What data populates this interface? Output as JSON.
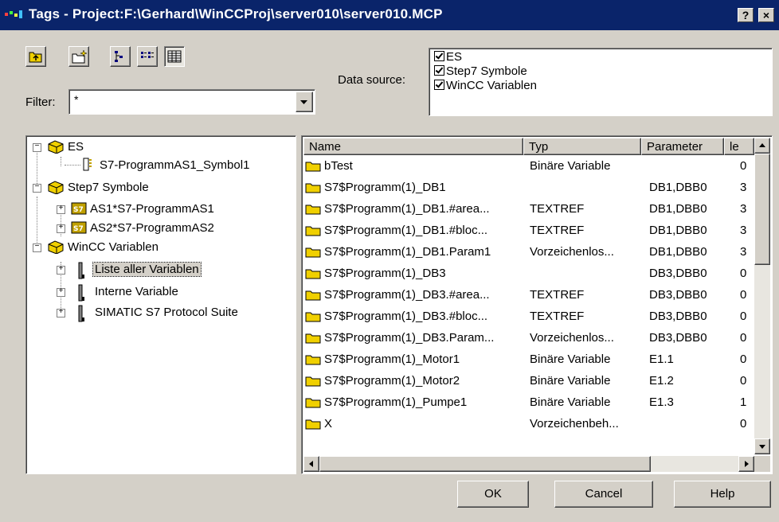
{
  "window": {
    "title": "Tags - Project:F:\\Gerhard\\WinCCProj\\server010\\server010.MCP",
    "help_btn": "?",
    "close_btn": "×"
  },
  "toolbar": {
    "icons": [
      "up-folder-icon",
      "new-folder-icon",
      "tree-view-icon",
      "list-view-icon",
      "details-view-icon"
    ]
  },
  "filter": {
    "label": "Filter:",
    "value": "*"
  },
  "datasource": {
    "label": "Data source:",
    "items": [
      {
        "label": "ES",
        "checked": true
      },
      {
        "label": "Step7 Symbole",
        "checked": true
      },
      {
        "label": "WinCC Variablen",
        "checked": true
      }
    ]
  },
  "tree": {
    "nodes": [
      {
        "label": "ES",
        "expander": "−"
      },
      {
        "label": "S7-ProgrammAS1_Symbol1"
      },
      {
        "label": "Step7 Symbole",
        "expander": "−"
      },
      {
        "label": "AS1*S7-ProgrammAS1",
        "expander": "+",
        "badge": "S7"
      },
      {
        "label": "AS2*S7-ProgrammAS2",
        "expander": "+",
        "badge": "S7"
      },
      {
        "label": "WinCC Variablen",
        "expander": "−"
      },
      {
        "label": "Liste aller Variablen",
        "expander": "+",
        "selected": true
      },
      {
        "label": "Interne Variable",
        "expander": "+"
      },
      {
        "label": "SIMATIC S7 Protocol Suite",
        "expander": "+"
      }
    ]
  },
  "table": {
    "columns": [
      "Name",
      "Typ",
      "Parameter",
      "le"
    ],
    "rows": [
      {
        "name": "bTest",
        "typ": "Binäre Variable",
        "param": "",
        "le": "0"
      },
      {
        "name": "S7$Programm(1)_DB1",
        "typ": "",
        "param": "DB1,DBB0",
        "le": "3"
      },
      {
        "name": "S7$Programm(1)_DB1.#area...",
        "typ": "TEXTREF",
        "param": "DB1,DBB0",
        "le": "3"
      },
      {
        "name": "S7$Programm(1)_DB1.#bloc...",
        "typ": "TEXTREF",
        "param": "DB1,DBB0",
        "le": "3"
      },
      {
        "name": "S7$Programm(1)_DB1.Param1",
        "typ": "Vorzeichenlos...",
        "param": "DB1,DBB0",
        "le": "3"
      },
      {
        "name": "S7$Programm(1)_DB3",
        "typ": "",
        "param": "DB3,DBB0",
        "le": "0"
      },
      {
        "name": "S7$Programm(1)_DB3.#area...",
        "typ": "TEXTREF",
        "param": "DB3,DBB0",
        "le": "0"
      },
      {
        "name": "S7$Programm(1)_DB3.#bloc...",
        "typ": "TEXTREF",
        "param": "DB3,DBB0",
        "le": "0"
      },
      {
        "name": "S7$Programm(1)_DB3.Param...",
        "typ": "Vorzeichenlos...",
        "param": "DB3,DBB0",
        "le": "0"
      },
      {
        "name": "S7$Programm(1)_Motor1",
        "typ": "Binäre Variable",
        "param": "E1.1",
        "le": "0"
      },
      {
        "name": "S7$Programm(1)_Motor2",
        "typ": "Binäre Variable",
        "param": "E1.2",
        "le": "0"
      },
      {
        "name": "S7$Programm(1)_Pumpe1",
        "typ": "Binäre Variable",
        "param": "E1.3",
        "le": "1"
      },
      {
        "name": "X",
        "typ": "Vorzeichenbeh...",
        "param": "",
        "le": "0"
      }
    ]
  },
  "buttons": {
    "ok": "OK",
    "cancel": "Cancel",
    "help": "Help"
  },
  "colors": {
    "titlebar": "#0a246a",
    "face": "#d4d0c8",
    "folder": "#f0d000"
  }
}
